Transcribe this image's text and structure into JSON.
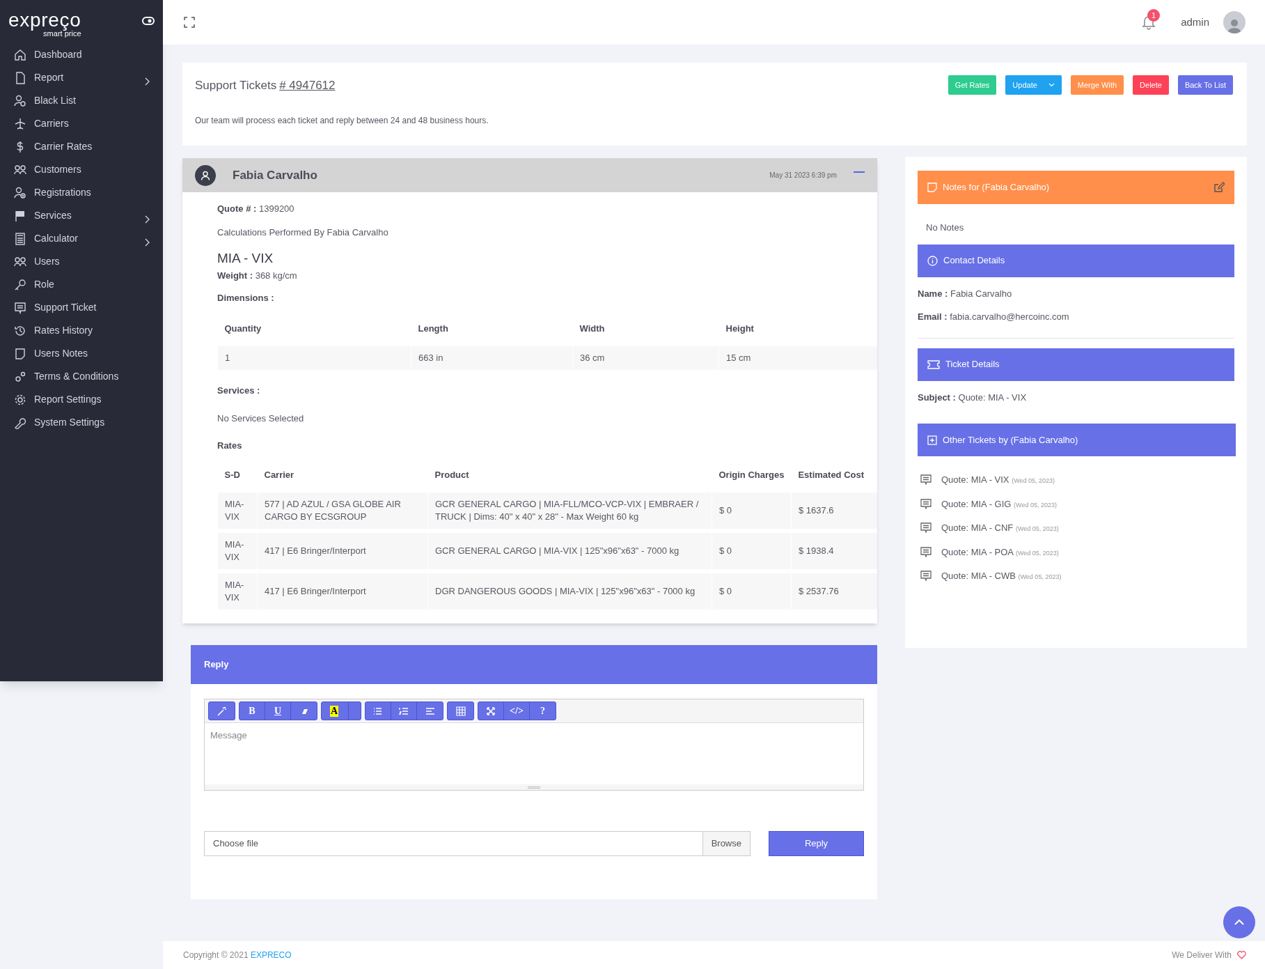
{
  "brand": {
    "name": "expreço",
    "tagline": "smart price"
  },
  "sidebar": {
    "items": [
      {
        "label": "Dashboard",
        "has_submenu": false
      },
      {
        "label": "Report",
        "has_submenu": true
      },
      {
        "label": "Black List",
        "has_submenu": false
      },
      {
        "label": "Carriers",
        "has_submenu": false
      },
      {
        "label": "Carrier Rates",
        "has_submenu": false
      },
      {
        "label": "Customers",
        "has_submenu": false
      },
      {
        "label": "Registrations",
        "has_submenu": false
      },
      {
        "label": "Services",
        "has_submenu": true
      },
      {
        "label": "Calculator",
        "has_submenu": true
      },
      {
        "label": "Users",
        "has_submenu": false
      },
      {
        "label": "Role",
        "has_submenu": false
      },
      {
        "label": "Support Ticket",
        "has_submenu": false
      },
      {
        "label": "Rates History",
        "has_submenu": false
      },
      {
        "label": "Users Notes",
        "has_submenu": false
      },
      {
        "label": "Terms & Conditions",
        "has_submenu": false
      },
      {
        "label": "Report Settings",
        "has_submenu": false
      },
      {
        "label": "System Settings",
        "has_submenu": false
      }
    ]
  },
  "header": {
    "notification_count": "1",
    "user": "admin"
  },
  "ticket_header": {
    "title": "Support Tickets",
    "ticket_number": "# 4947612",
    "note": "Our team will process each ticket and reply between 24 and 48 business hours.",
    "buttons": [
      {
        "label": "Get Rates",
        "color": "#2ecc8f",
        "dropdown": false
      },
      {
        "label": "Update",
        "color": "#1fa2f0",
        "dropdown": true
      },
      {
        "label": "Merge With",
        "color": "#ff8f4a",
        "dropdown": false
      },
      {
        "label": "Delete",
        "color": "#fd4258",
        "dropdown": false
      },
      {
        "label": "Back To List",
        "color": "#6770e6",
        "dropdown": false
      }
    ]
  },
  "message": {
    "author": "Fabia Carvalho",
    "date": "May 31 2023 6:39 pm",
    "quote_label": "Quote # :",
    "quote": "1399200",
    "performed_by": "Calculations Performed By Fabia Carvalho",
    "route": "MIA - VIX",
    "weight_label": "Weight :",
    "weight": "368 kg/cm",
    "dimensions_label": "Dimensions :",
    "dimensions": {
      "columns": [
        "Quantity",
        "Length",
        "Width",
        "Height"
      ],
      "rows": [
        [
          "1",
          "663 in",
          "36 cm",
          "15 cm"
        ]
      ]
    },
    "services_label": "Services :",
    "services": "No Services Selected",
    "rates_label": "Rates",
    "rates": {
      "columns": [
        "S-D",
        "Carrier",
        "Product",
        "Origin Charges",
        "Estimated Cost"
      ],
      "rows": [
        [
          "MIA-VIX",
          "577 | AD AZUL / GSA GLOBE AIR CARGO BY ECSGROUP",
          "GCR GENERAL CARGO | MIA-FLL/MCO-VCP-VIX | EMBRAER / TRUCK | Dims: 40\" x 40\" x 28\" - Max Weight 60 kg",
          "$ 0",
          "$ 1637.6"
        ],
        [
          "MIA-VIX",
          "417 | E6 Bringer/Interport",
          "GCR GENERAL CARGO | MIA-VIX | 125\"x96\"x63\" - 7000 kg",
          "$ 0",
          "$ 1938.4"
        ],
        [
          "MIA-VIX",
          "417 | E6 Bringer/Interport",
          "DGR DANGEROUS GOODS | MIA-VIX | 125\"x96\"x63\" - 7000 kg",
          "$ 0",
          "$ 2537.76"
        ]
      ]
    }
  },
  "side_panel": {
    "notes": {
      "title": "Notes for (Fabia Carvalho)",
      "empty": "No Notes"
    },
    "contact": {
      "title": "Contact Details",
      "fields": [
        {
          "label": "Name :",
          "value": "Fabia Carvalho"
        },
        {
          "label": "Email :",
          "value": "fabia.carvalho@hercoinc.com"
        }
      ]
    },
    "ticket_details": {
      "title": "Ticket Details",
      "fields": [
        {
          "label": "Subject :",
          "value": "Quote: MIA - VIX"
        }
      ]
    },
    "other_tickets": {
      "title": "Other Tickets by (Fabia Carvalho)",
      "items": [
        {
          "title": "Quote: MIA - VIX",
          "date": "(Wed 05, 2023)"
        },
        {
          "title": "Quote: MIA - GIG",
          "date": "(Wed 05, 2023)"
        },
        {
          "title": "Quote: MIA - CNF",
          "date": "(Wed 05, 2023)"
        },
        {
          "title": "Quote: MIA - POA",
          "date": "(Wed 05, 2023)"
        },
        {
          "title": "Quote: MIA - CWB",
          "date": "(Wed 05, 2023)"
        }
      ]
    }
  },
  "reply": {
    "title": "Reply",
    "toolbar": [
      [
        {
          "kind": "icon"
        }
      ],
      [
        {
          "kind": "text",
          "label": "B"
        },
        {
          "kind": "text",
          "label": "U"
        },
        {
          "kind": "icon"
        }
      ],
      [
        {
          "kind": "highlight",
          "label": "A"
        }
      ],
      [
        {
          "kind": "icon"
        },
        {
          "kind": "icon"
        },
        {
          "kind": "icon"
        }
      ],
      [
        {
          "kind": "icon"
        }
      ],
      [
        {
          "kind": "icon"
        },
        {
          "kind": "text",
          "label": "</>"
        },
        {
          "kind": "text",
          "label": "?"
        }
      ]
    ],
    "placeholder": "Message",
    "file_placeholder": "Choose file",
    "browse": "Browse",
    "submit": "Reply"
  },
  "footer": {
    "copyright": "Copyright © 2021",
    "brand": "EXPRECO",
    "tagline": "We Deliver With"
  }
}
